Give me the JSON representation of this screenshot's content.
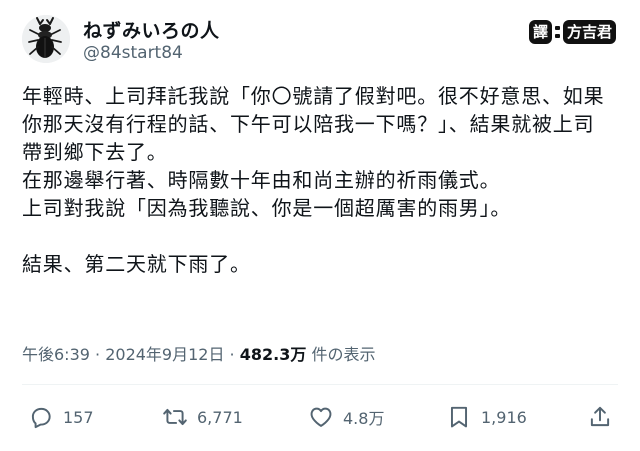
{
  "tweet": {
    "display_name": "ねずみいろの人",
    "handle": "@84start84",
    "translator_badge": {
      "part1": "譯",
      "part2": "方吉君"
    },
    "lines": [
      "年輕時、上司拜託我說「你〇號請了假對吧。很不好意思、如果",
      "你那天沒有行程的話、下午可以陪我一下嗎？」、結果就被上司",
      "帶到鄉下去了。",
      "在那邊舉行著、時隔數十年由和尚主辦的祈雨儀式。",
      "上司對我說「因為我聽說、你是一個超厲害的雨男」。",
      "",
      "結果、第二天就下雨了。"
    ],
    "meta": {
      "time": "午後6:39",
      "separator1": " · ",
      "date": "2024年9月12日",
      "separator2": " · ",
      "views": "482.3万",
      "views_label": " 件の表示"
    },
    "actions": {
      "replies": "157",
      "reposts": "6,771",
      "likes": "4.8万",
      "bookmarks": "1,916"
    }
  },
  "icons": {
    "avatar": "stag-beetle-avatar",
    "reply": "reply-icon",
    "repost": "repost-icon",
    "like": "heart-icon",
    "bookmark": "bookmark-icon",
    "share": "share-icon"
  },
  "colors": {
    "text": "#0f1419",
    "secondary": "#536471",
    "badge_bg": "#111111"
  }
}
